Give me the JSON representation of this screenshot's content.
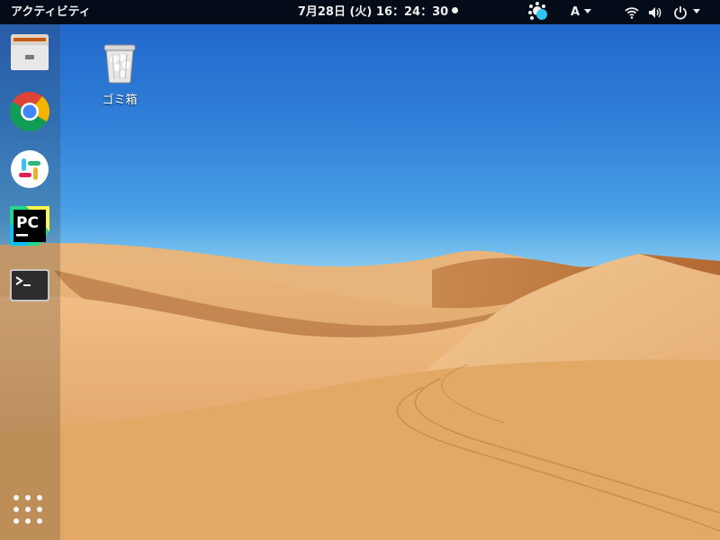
{
  "topbar": {
    "activities": "アクティビティ",
    "clock": "7月28日 (火) 16：24：30",
    "input_method": "A",
    "tray_icon": "colorful-app-indicator-icon",
    "status_icons": [
      "wifi-icon",
      "volume-icon",
      "power-icon"
    ]
  },
  "dock": {
    "items": [
      {
        "name": "files",
        "icon": "file-cabinet-icon"
      },
      {
        "name": "chrome",
        "icon": "chrome-icon"
      },
      {
        "name": "slack",
        "icon": "slack-icon"
      },
      {
        "name": "pycharm",
        "icon": "pycharm-icon",
        "text": "PC"
      },
      {
        "name": "terminal",
        "icon": "terminal-icon"
      }
    ],
    "show_apps_icon": "app-grid-icon"
  },
  "desktop": {
    "trash_label": "ゴミ箱"
  },
  "colors": {
    "topbar_bg": "#000000",
    "sky_top": "#1f62c8",
    "sky_horizon": "#9dd2ef",
    "sand_light": "#f2c58c",
    "sand_dark": "#b96b2f"
  }
}
